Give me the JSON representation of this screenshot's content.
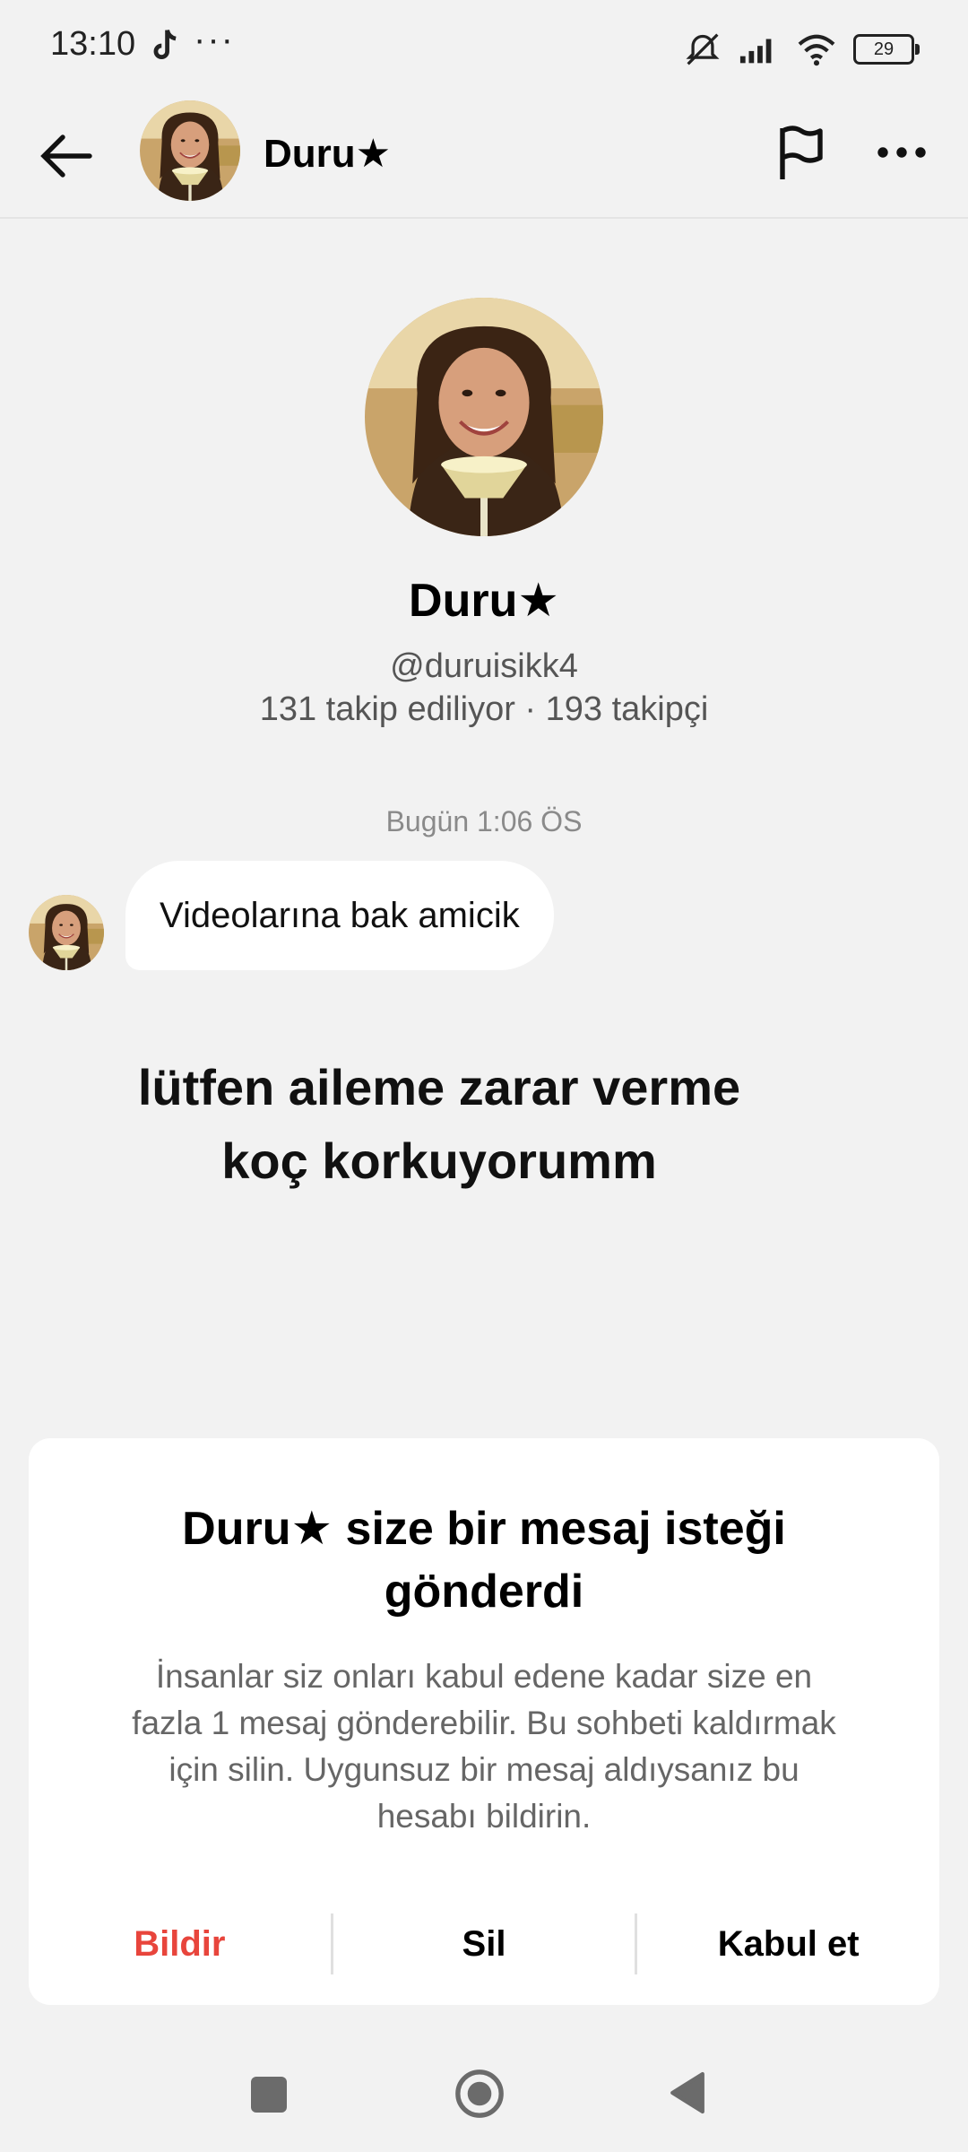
{
  "status_bar": {
    "time": "13:10",
    "dots": "···",
    "battery": "29",
    "icons": [
      "tiktok-icon",
      "muted-icon",
      "signal-icon",
      "wifi-icon",
      "battery-icon"
    ]
  },
  "header": {
    "name": "Duru★",
    "icons": [
      "back-arrow-icon",
      "flag-icon",
      "more-icon"
    ]
  },
  "profile": {
    "name": "Duru★",
    "handle": "@duruisikk4",
    "stats": "131 takip ediliyor · 193 takipçi"
  },
  "chat": {
    "timestamp": "Bugün 1:06 ÖS",
    "message": "Videolarına bak amicik"
  },
  "overlay": {
    "line1": "lütfen aileme zarar verme",
    "line2": "koç korkuyorumm"
  },
  "request": {
    "title": "Duru★ size bir mesaj isteği gönderdi",
    "description": "İnsanlar siz onları kabul edene kadar size en fazla 1 mesaj gönderebilir. Bu sohbeti kaldırmak için silin. Uygunsuz bir mesaj aldıysanız bu hesabı bildirin.",
    "report_label": "Bildir",
    "delete_label": "Sil",
    "accept_label": "Kabul et",
    "report_color": "#e8453c"
  }
}
